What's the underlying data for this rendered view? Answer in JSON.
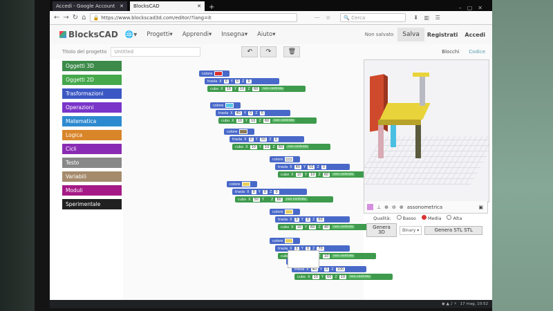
{
  "browser": {
    "tabs": [
      {
        "label": "Accedi - Google Account",
        "active": false
      },
      {
        "label": "BlocksCAD",
        "active": true
      }
    ],
    "url": "https://www.blockscad3d.com/editor/?lang=it",
    "search_placeholder": "Cerca"
  },
  "header": {
    "logo": "BlocksCAD",
    "menu": [
      "Progetti",
      "Apprendi",
      "Insegna",
      "Aiuto"
    ],
    "status": "Non salvato",
    "save_label": "Salva",
    "register_label": "Registrati",
    "login_label": "Accedi"
  },
  "project": {
    "title_label": "Titolo del progetto",
    "title_value": "Untitled"
  },
  "view_tabs": {
    "blocks": "Blocchi",
    "code": "Codice"
  },
  "categories": [
    {
      "label": "Oggetti 3D",
      "color": "#3d8a4a"
    },
    {
      "label": "Oggetti 2D",
      "color": "#45a84b"
    },
    {
      "label": "Trasformazioni",
      "color": "#3b57c4"
    },
    {
      "label": "Operazioni",
      "color": "#7a35c9"
    },
    {
      "label": "Matematica",
      "color": "#2e8ad0"
    },
    {
      "label": "Logica",
      "color": "#d9852a"
    },
    {
      "label": "Cicli",
      "color": "#8a2cb3"
    },
    {
      "label": "Testo",
      "color": "#888888"
    },
    {
      "label": "Variabili",
      "color": "#a58b6c"
    },
    {
      "label": "Moduli",
      "color": "#a51a86"
    },
    {
      "label": "Sperimentale",
      "color": "#202020"
    }
  ],
  "blocks": {
    "color_label": "colore",
    "translate_label": "trasla",
    "cube_label": "cubo",
    "not_centered": "non centrato",
    "x": "X",
    "y": "Y",
    "z": "Z",
    "groups": [
      {
        "color": "#d93030",
        "t": [
          "0",
          "0",
          "0"
        ],
        "c": [
          "10",
          "10",
          "60"
        ]
      },
      {
        "color": "#55c8e8",
        "t": [
          "40",
          "0",
          "0"
        ],
        "c": [
          "10",
          "10",
          "60"
        ]
      },
      {
        "color": "#8a7a55",
        "t": [
          "0",
          "50",
          "0"
        ],
        "c": [
          "10",
          "10",
          "60"
        ]
      },
      {
        "color": "#cccccc",
        "t": [
          "40",
          "50",
          "0"
        ],
        "c": [
          "10",
          "10",
          "60"
        ]
      },
      {
        "color": "#e8d060",
        "t": [
          "0",
          "0",
          "0"
        ],
        "c": [
          "50",
          "",
          "60"
        ]
      },
      {
        "color": "#e8d060",
        "t": [
          "0",
          "0",
          "60"
        ],
        "c": [
          "10",
          "60",
          "40"
        ]
      },
      {
        "color": "#e8d060",
        "t": [
          "0",
          "0",
          "70"
        ],
        "c": [
          "10",
          "60",
          "10"
        ]
      },
      {
        "color": "#e8d060",
        "t": [
          "40",
          "0",
          "100"
        ],
        "c": [
          "10",
          "60",
          "10"
        ]
      }
    ]
  },
  "viewer": {
    "projection": "assonometrica",
    "quality_label": "Qualità:",
    "quality_options": [
      "Basso",
      "Media",
      "Alta"
    ],
    "quality_selected": "Media",
    "render_button": "Genera 3D",
    "format": "Binary",
    "stl_button": "Genera STL STL"
  },
  "taskbar": {
    "time": "17 mag, 10:52"
  }
}
